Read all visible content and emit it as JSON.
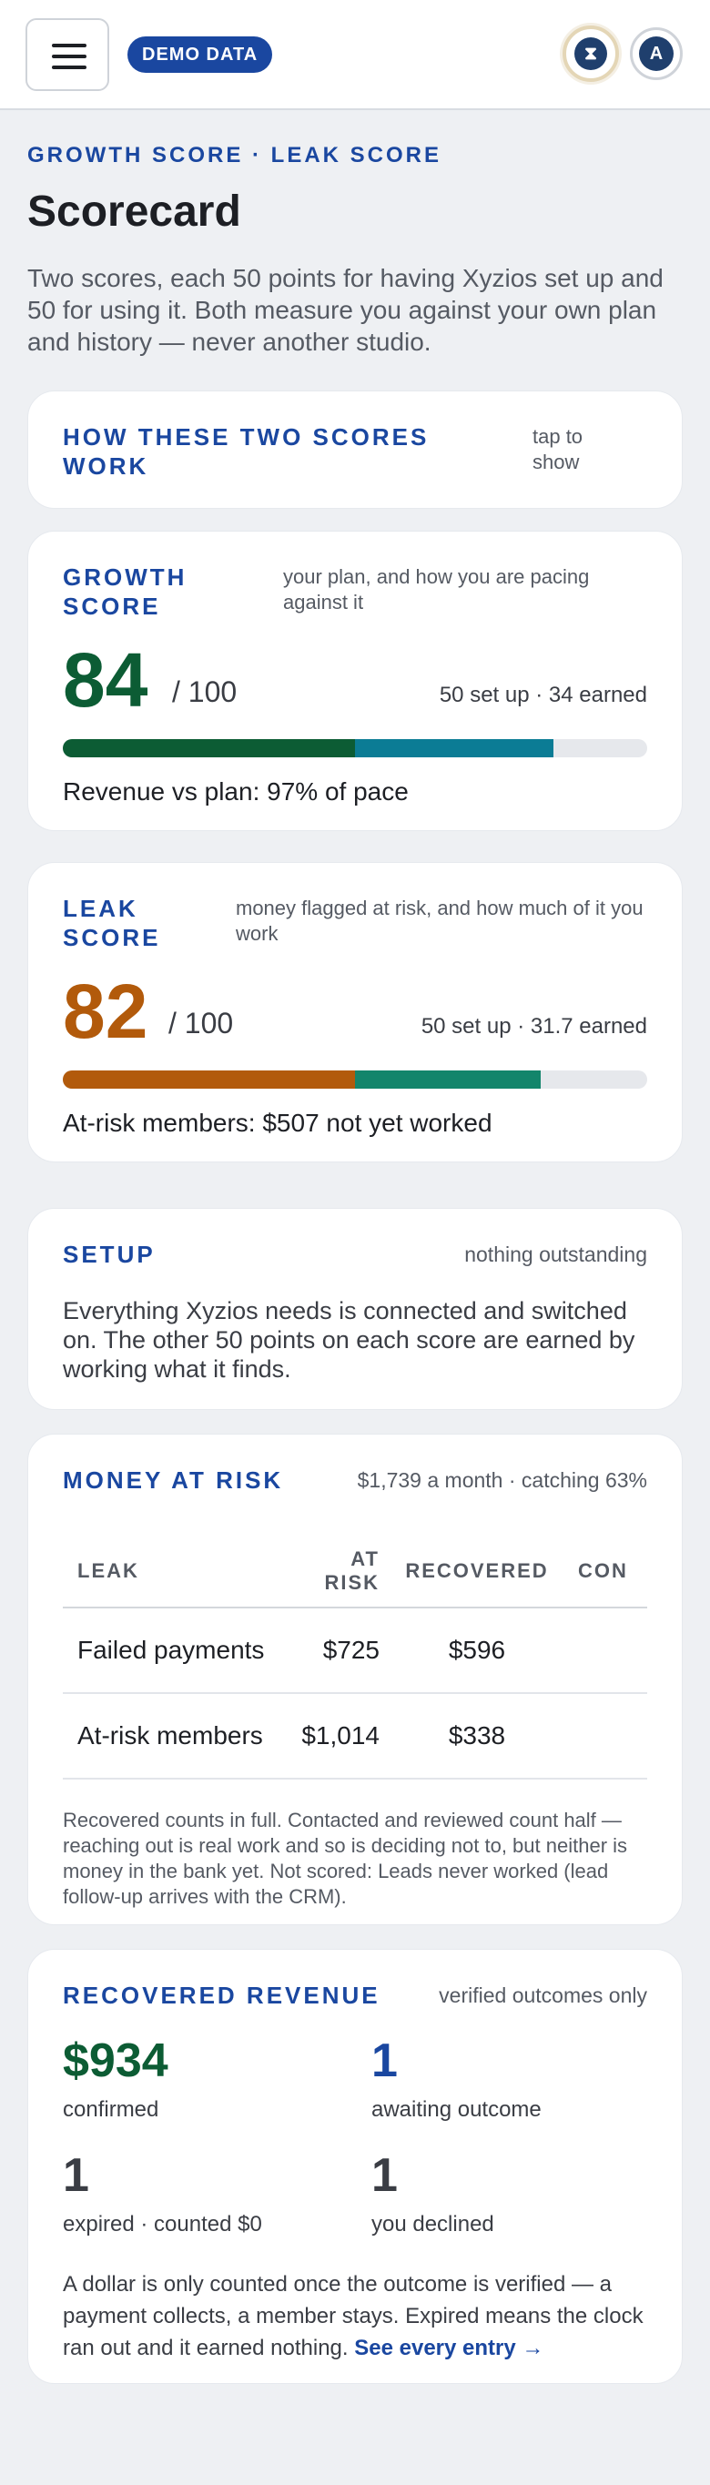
{
  "header": {
    "demo_badge": "DEMO DATA",
    "logo_glyph": "⧗",
    "avatar_initial": "A"
  },
  "page": {
    "eyebrow": "GROWTH SCORE · LEAK SCORE",
    "title": "Scorecard",
    "intro": "Two scores, each 50 points for having Xyzios set up and 50 for using it. Both measure you against your own plan and history — never another studio."
  },
  "how_it_works": {
    "title": "HOW THESE TWO SCORES WORK",
    "toggle_hint": "tap to show"
  },
  "growth_score": {
    "title": "GROWTH SCORE",
    "hint": "your plan, and how you are pacing against it",
    "score": "84",
    "out_of": "/ 100",
    "breakdown": "50 set up · 34 earned",
    "setup_points": 50,
    "earned_points": 34,
    "max_points": 100,
    "footer": "Revenue vs plan: 97% of pace",
    "colors": {
      "score": "#0c5c34",
      "setup": "#0c5c34",
      "earned": "#0b7c95"
    }
  },
  "leak_score": {
    "title": "LEAK SCORE",
    "hint": "money flagged at risk, and how much of it you work",
    "score": "82",
    "out_of": "/ 100",
    "breakdown": "50 set up · 31.7 earned",
    "setup_points": 50,
    "earned_points": 31.7,
    "max_points": 100,
    "footer": "At-risk members: $507 not yet worked",
    "colors": {
      "score": "#b25a0b",
      "setup": "#b25a0b",
      "earned": "#13856b"
    }
  },
  "setup": {
    "title": "SETUP",
    "status": "nothing outstanding",
    "body": "Everything Xyzios needs is connected and switched on. The other 50 points on each score are earned by working what it finds."
  },
  "money_at_risk": {
    "title": "MONEY AT RISK",
    "summary": "$1,739 a month · catching 63%",
    "columns": [
      "LEAK",
      "AT RISK",
      "RECOVERED",
      "CON"
    ],
    "rows": [
      {
        "leak": "Failed payments",
        "at_risk": "$725",
        "recovered": "$596"
      },
      {
        "leak": "At-risk members",
        "at_risk": "$1,014",
        "recovered": "$338"
      }
    ],
    "note": "Recovered counts in full. Contacted and reviewed count half — reaching out is real work and so is deciding not to, but neither is money in the bank yet. Not scored: Leads never worked (lead follow-up arrives with the CRM)."
  },
  "recovered_revenue": {
    "title": "RECOVERED REVENUE",
    "hint": "verified outcomes only",
    "stats": [
      {
        "value": "$934",
        "label": "confirmed",
        "color": "#0c5c34"
      },
      {
        "value": "1",
        "label": "awaiting outcome",
        "color": "#1a47a0"
      },
      {
        "value": "1",
        "label": "expired · counted $0",
        "color": "#3a3d44"
      },
      {
        "value": "1",
        "label": "you declined",
        "color": "#3a3d44"
      }
    ],
    "note": "A dollar is only counted once the outcome is verified — a payment collects, a member stays. Expired means the clock ran out and it earned nothing.",
    "link_label": "See every entry →"
  }
}
